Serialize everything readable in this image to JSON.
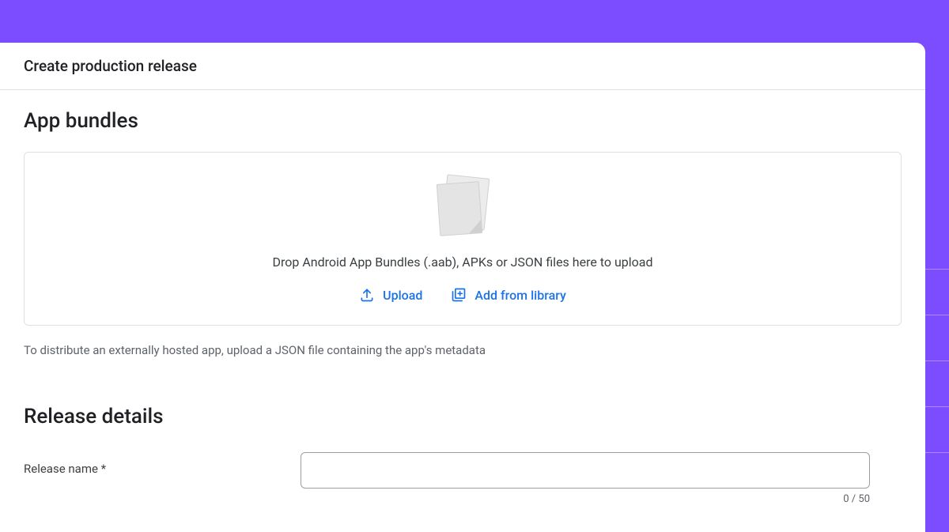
{
  "header": {
    "title": "Create production release"
  },
  "app_bundles": {
    "section_title": "App bundles",
    "drop_text": "Drop Android App Bundles (.aab), APKs or JSON files here to upload",
    "upload_label": "Upload",
    "library_label": "Add from library",
    "helper_text": "To distribute an externally hosted app, upload a JSON file containing the app's metadata"
  },
  "release_details": {
    "section_title": "Release details",
    "name_label": "Release name  *",
    "name_value": "",
    "char_count": "0 / 50"
  }
}
